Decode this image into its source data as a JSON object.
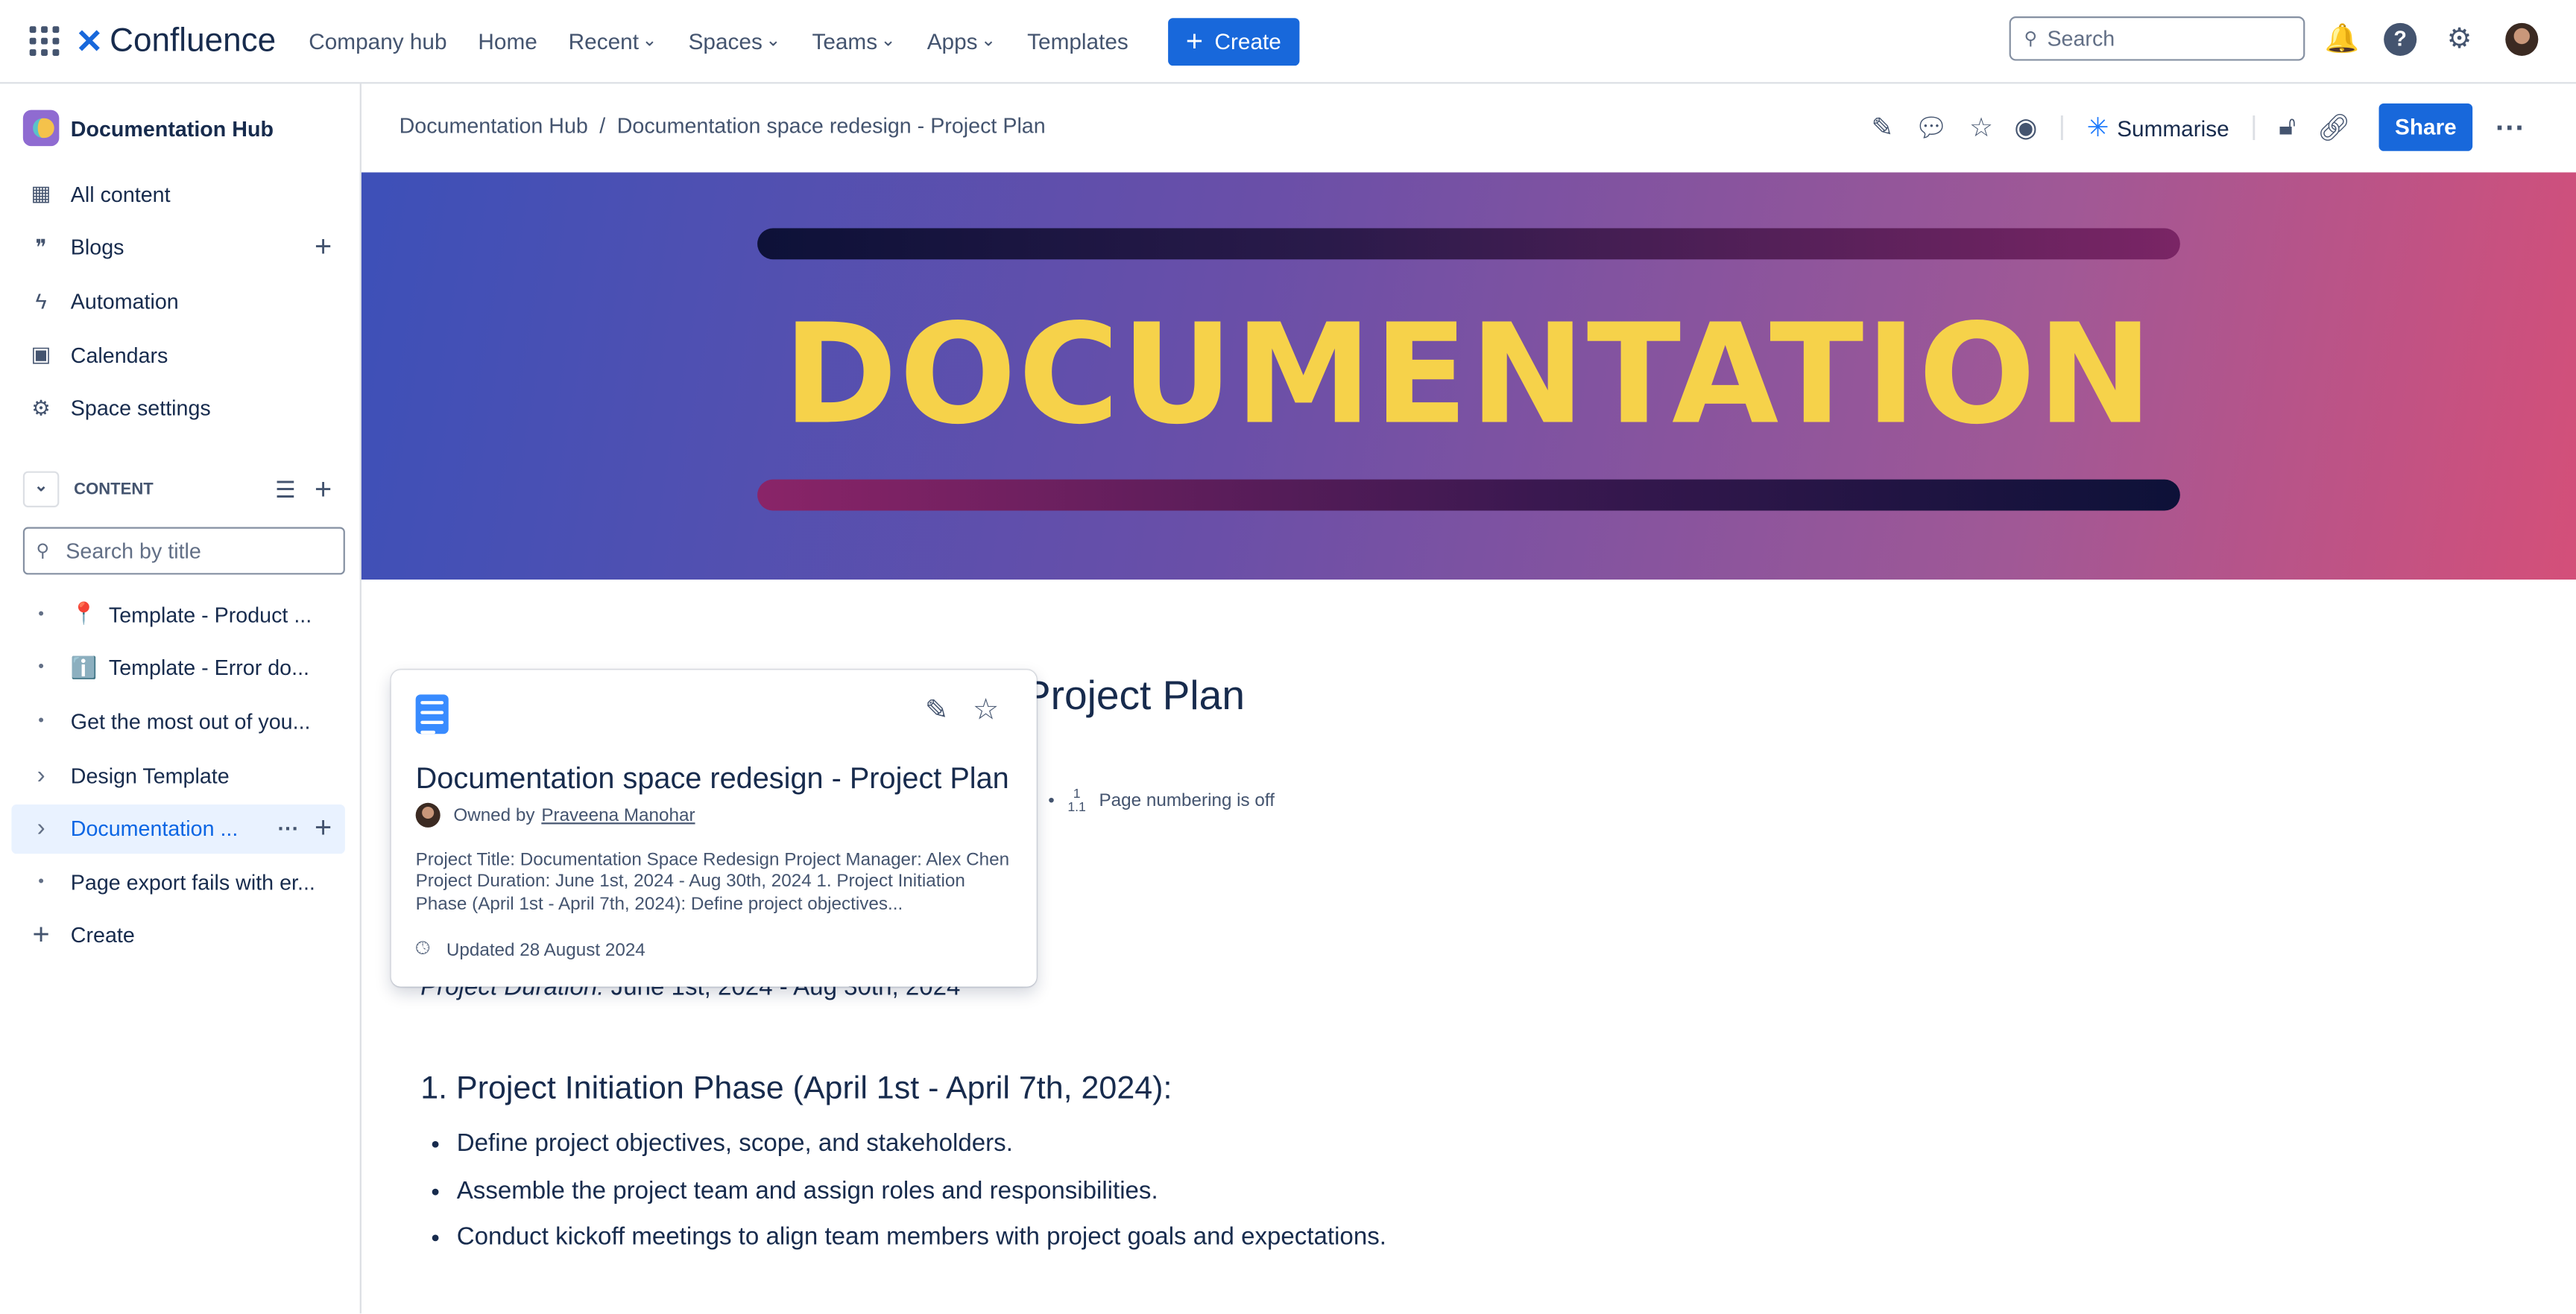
{
  "topbar": {
    "app_name": "Confluence",
    "nav": [
      "Company hub",
      "Home",
      "Recent",
      "Spaces",
      "Teams",
      "Apps",
      "Templates"
    ],
    "nav_has_chevron": [
      false,
      false,
      true,
      true,
      true,
      true,
      false
    ],
    "create_label": "Create",
    "search_placeholder": "Search"
  },
  "sidebar": {
    "space_name": "Documentation Hub",
    "items": [
      {
        "label": "All content",
        "icon": "grid-icon"
      },
      {
        "label": "Blogs",
        "icon": "quote-icon"
      },
      {
        "label": "Automation",
        "icon": "lightning-icon"
      },
      {
        "label": "Calendars",
        "icon": "calendar-icon"
      },
      {
        "label": "Space settings",
        "icon": "gear-icon"
      }
    ],
    "content_header": "CONTENT",
    "search_placeholder": "Search by title",
    "tree": [
      {
        "label": "Template - Product ...",
        "emoji": "📍"
      },
      {
        "label": "Template - Error do...",
        "emoji": "ℹ️"
      },
      {
        "label": "Get the most out of you...",
        "emoji": ""
      },
      {
        "label": "Design Template",
        "emoji": ""
      },
      {
        "label": "Documentation ...",
        "emoji": "",
        "selected": true
      },
      {
        "label": "Page export fails with er...",
        "emoji": ""
      }
    ],
    "create_label": "Create"
  },
  "breadcrumb": [
    "Documentation Hub",
    "Documentation space redesign - Project Plan"
  ],
  "actions": {
    "summarise_label": "Summarise",
    "share_label": "Share"
  },
  "banner": {
    "title": "DOCUMENTATION"
  },
  "page": {
    "title": "Documentation space redesign - Project Plan",
    "page_numbering": "Page numbering is off",
    "duration_label": "Project Duration:",
    "duration_value": " June 1st, 2024 - Aug 30th, 2024",
    "section_heading": "1. Project Initiation Phase (April 1st - April 7th, 2024):",
    "bullets": [
      "Define project objectives, scope, and stakeholders.",
      "Assemble the project team and assign roles and responsibilities.",
      "Conduct kickoff meetings to align team members with project goals and expectations."
    ]
  },
  "hover_card": {
    "title": "Documentation space redesign - Project Plan",
    "owned_by": "Owned by",
    "owner": "Praveena Manohar",
    "excerpt": "Project Title: Documentation Space Redesign Project Manager: Alex Chen Project Duration: June 1st, 2024 - Aug 30th, 2024 1. Project Initiation Phase (April 1st - April 7th, 2024): Define project objectives...",
    "updated": "Updated 28 August 2024"
  },
  "colors": {
    "primary": "#1868db",
    "banner_text": "#f6d24a"
  }
}
